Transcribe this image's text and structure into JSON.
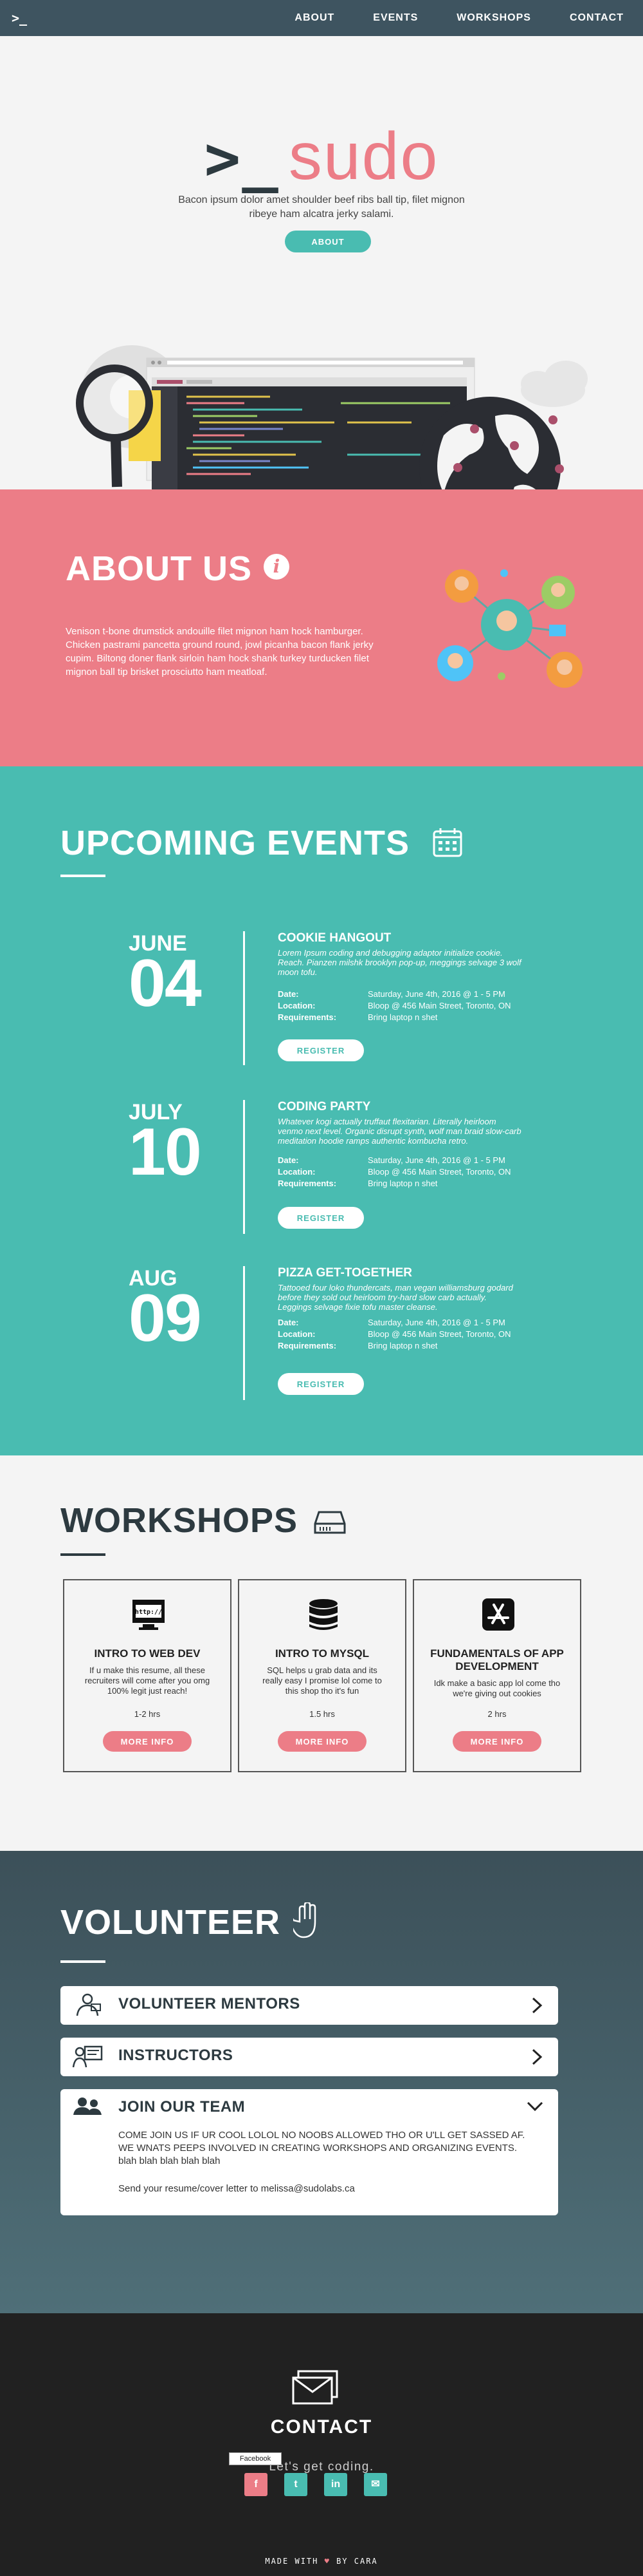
{
  "nav": {
    "logo": ">_",
    "items": [
      "ABOUT",
      "EVENTS",
      "WORKSHOPS",
      "CONTACT"
    ]
  },
  "hero": {
    "brand_prompt": ">_",
    "brand_name": "sudo",
    "tagline": "Bacon ipsum dolor amet shoulder beef ribs ball tip, filet mignon ribeye ham alcatra jerky salami.",
    "button": "ABOUT"
  },
  "about": {
    "title": "ABOUT US",
    "text": "Venison t-bone drumstick andouille filet mignon ham hock hamburger. Chicken pastrami pancetta ground round, jowl picanha bacon flank jerky cupim. Biltong doner flank sirloin ham hock shank turkey turducken filet mignon ball tip brisket prosciutto ham meatloaf."
  },
  "events": {
    "title": "UPCOMING EVENTS",
    "labels": {
      "date": "Date:",
      "location": "Location:",
      "requirements": "Requirements:"
    },
    "items": [
      {
        "month": "JUNE",
        "day": "04",
        "title": "COOKIE HANGOUT",
        "desc": "Lorem Ipsum coding and debugging adaptor initialize cookie. Reach. Pianzen milshk brooklyn pop-up, meggings selvage 3 wolf moon tofu.",
        "date": "Saturday, June 4th, 2016 @ 1 - 5 PM",
        "location": "Bloop @ 456 Main Street, Toronto, ON",
        "requirements": "Bring laptop n shet",
        "button": "REGISTER"
      },
      {
        "month": "JULY",
        "day": "10",
        "title": "CODING PARTY",
        "desc": "Whatever kogi actually truffaut flexitarian. Literally heirloom venmo next level. Organic disrupt synth, wolf man braid slow-carb meditation hoodie ramps authentic kombucha retro.",
        "date": "Saturday, June 4th, 2016 @ 1 - 5 PM",
        "location": "Bloop @ 456 Main Street, Toronto, ON",
        "requirements": "Bring laptop n shet",
        "button": "REGISTER"
      },
      {
        "month": "AUG",
        "day": "09",
        "title": "PIZZA GET-TOGETHER",
        "desc": "Tattooed four loko thundercats, man vegan williamsburg godard before they sold out heirloom try-hard slow carb actually. Leggings selvage fixie tofu master cleanse.",
        "date": "Saturday, June 4th, 2016 @ 1 - 5 PM",
        "location": "Bloop @ 456 Main Street, Toronto, ON",
        "requirements": "Bring laptop n shet",
        "button": "REGISTER"
      }
    ]
  },
  "workshops": {
    "title": "WORKSHOPS",
    "items": [
      {
        "icon_text": "http://",
        "title": "INTRO TO WEB DEV",
        "desc": "If u make this resume, all these recruiters will come after you omg 100% legit just reach!",
        "duration": "1-2 hrs",
        "button": "MORE INFO"
      },
      {
        "title": "INTRO TO MYSQL",
        "desc": "SQL helps u grab data and its really easy I promise lol come to this shop tho it's fun",
        "duration": "1.5 hrs",
        "button": "MORE INFO"
      },
      {
        "title": "FUNDAMENTALS OF APP DEVELOPMENT",
        "desc": "Idk make a basic app lol come tho we're giving out cookies",
        "duration": "2 hrs",
        "button": "MORE INFO"
      }
    ]
  },
  "volunteer": {
    "title": "VOLUNTEER",
    "items": [
      {
        "label": "VOLUNTEER MENTORS"
      },
      {
        "label": "INSTRUCTORS"
      },
      {
        "label": "JOIN OUR TEAM",
        "body": "COME JOIN US IF UR COOL LOLOL NO NOOBS ALLOWED THO OR U'LL GET SASSED AF. WE WNATS PEEPS INVOLVED IN CREATING WORKSHOPS AND ORGANIZING EVENTS. blah blah blah blah blah",
        "body2": "Send your resume/cover letter to melissa@sudolabs.ca"
      }
    ]
  },
  "footer": {
    "title": "CONTACT",
    "subtitle": "Let's get coding.",
    "tooltip": "Facebook",
    "made_prefix": "MADE WITH",
    "made_heart": "♥",
    "made_suffix": "BY CARA",
    "colors": {
      "facebook": "#ec7d87",
      "twitter": "#49bcb1",
      "linkedin": "#49bcb1",
      "email": "#49bcb1"
    }
  }
}
